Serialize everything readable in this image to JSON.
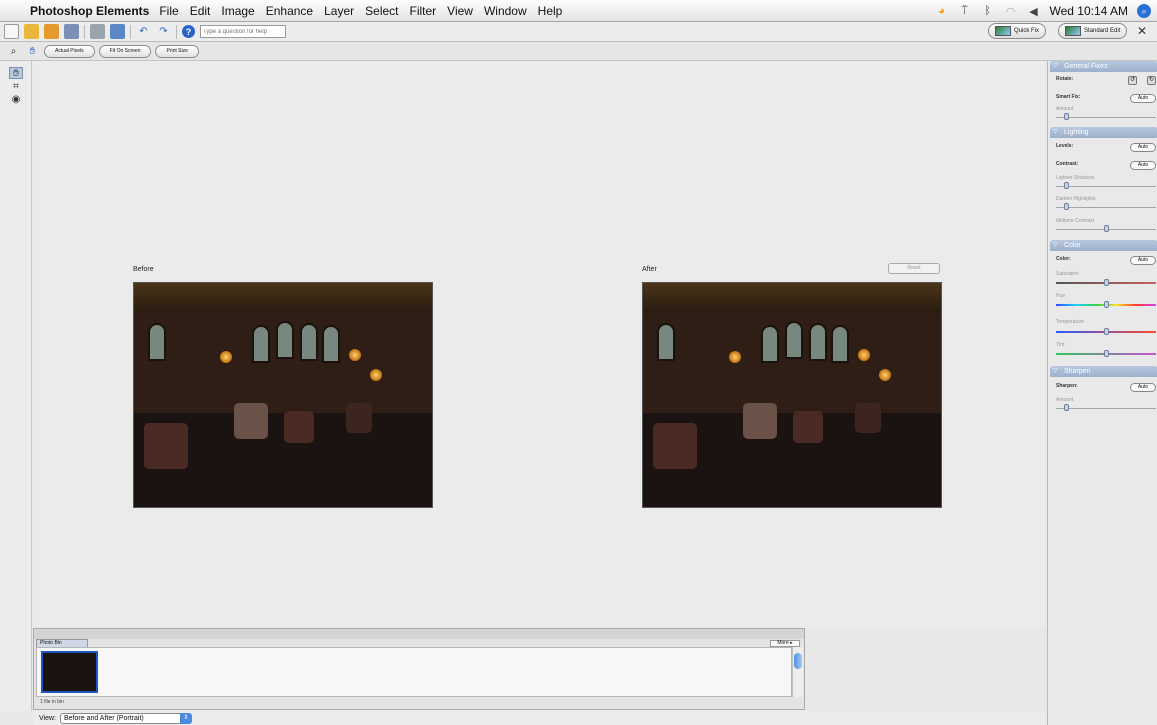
{
  "menubar": {
    "app_name": "Photoshop Elements",
    "items": [
      "File",
      "Edit",
      "Image",
      "Enhance",
      "Layer",
      "Select",
      "Filter",
      "View",
      "Window",
      "Help"
    ],
    "clock": "Wed 10:14 AM"
  },
  "toolbar": {
    "help_placeholder": "Type a question for help",
    "quick_fix_label": "Quick Fix",
    "standard_edit_label": "Standard Edit",
    "close_label": "✕"
  },
  "options": {
    "actual_pixels": "Actual Pixels",
    "fit_on_screen": "Fit On Screen",
    "print_size": "Print Size"
  },
  "workspace": {
    "before_label": "Before",
    "after_label": "After",
    "reset_label": "Reset"
  },
  "palette": {
    "general_fixes": {
      "title": "General Fixes",
      "rotate_label": "Rotate:",
      "smart_fix_label": "Smart Fix:",
      "auto_label": "Auto",
      "amount_label": "Amount",
      "amount_value": 0.06
    },
    "lighting": {
      "title": "Lighting",
      "levels_label": "Levels:",
      "contrast_label": "Contrast:",
      "auto_label": "Auto",
      "lighten_shadows_label": "Lighten Shadows",
      "darken_highlights_label": "Darken Highlights",
      "midtone_contrast_label": "Midtone Contrast",
      "lighten_shadows_value": 0.06,
      "darken_highlights_value": 0.06,
      "midtone_contrast_value": 0.5
    },
    "color": {
      "title": "Color",
      "color_label": "Color:",
      "auto_label": "Auto",
      "saturation_label": "Saturation",
      "hue_label": "Hue",
      "temperature_label": "Temperature",
      "tint_label": "Tint"
    },
    "sharpen": {
      "title": "Sharpen",
      "sharpen_label": "Sharpen:",
      "auto_label": "Auto",
      "amount_label": "Amount",
      "amount_value": 0.06
    }
  },
  "photo_bin": {
    "tab_label": "Photo Bin",
    "more_label": "More ▸",
    "status": "1 file in bin"
  },
  "viewbar": {
    "view_label": "View:",
    "view_value": "Before and After (Portrait)"
  },
  "colors": {
    "accent": "#2a6fd6",
    "panel_header": "#9db0cc"
  }
}
